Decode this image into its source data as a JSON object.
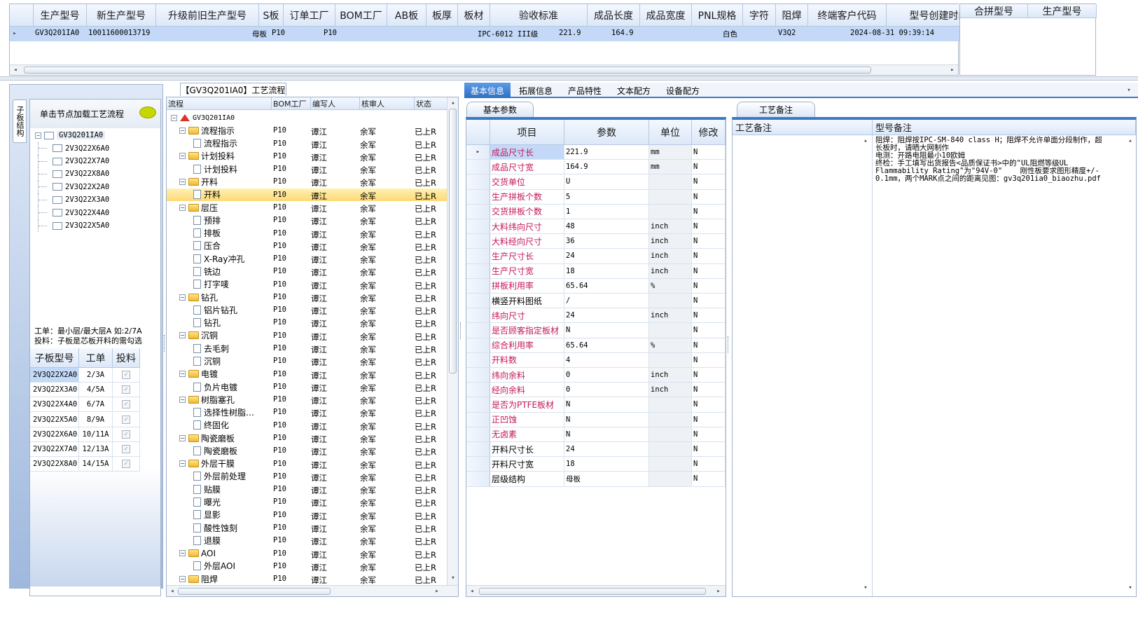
{
  "top_grid": {
    "columns": [
      "生产型号",
      "新生产型号",
      "升级前旧生产型号",
      "S板",
      "订单工厂",
      "BOM工厂",
      "AB板",
      "板厚",
      "板材",
      "验收标准",
      "成品长度",
      "成品宽度",
      "PNL规格",
      "字符",
      "阻焊",
      "终端客户代码",
      "型号创建时间"
    ],
    "row": {
      "prod_model": "GV3Q201IA0",
      "new_model": "10011600013719",
      "s_board": "母板",
      "order_factory": "P10",
      "bom_factory": "P10",
      "standard": "IPC-6012 III级",
      "length": "221.9",
      "width": "164.9",
      "char": "白色",
      "customer": "V3Q2",
      "created": "2024-08-31 09:39:14"
    },
    "side_columns": [
      "合拼型号",
      "生产型号"
    ]
  },
  "left_panel": {
    "vertical_tab": "子板结构",
    "hint": "单击节点加载工艺流程",
    "tree_root": "GV3Q201IA0",
    "tree_children": [
      "2V3Q22X6A0",
      "2V3Q22X7A0",
      "2V3Q22X8A0",
      "2V3Q22X2A0",
      "2V3Q22X3A0",
      "2V3Q22X4A0",
      "2V3Q22X5A0"
    ],
    "note_line1": "工单：最小层/最大层A 如:2/7A",
    "note_line2": "投料：子板是芯板开料的需勾选",
    "sub_columns": [
      "子板型号",
      "工单",
      "投料"
    ],
    "sub_rows": [
      {
        "model": "2V3Q22X2A0",
        "order": "2/3A"
      },
      {
        "model": "2V3Q22X3A0",
        "order": "4/5A"
      },
      {
        "model": "2V3Q22X4A0",
        "order": "6/7A"
      },
      {
        "model": "2V3Q22X5A0",
        "order": "8/9A"
      },
      {
        "model": "2V3Q22X6A0",
        "order": "10/11A"
      },
      {
        "model": "2V3Q22X7A0",
        "order": "12/13A"
      },
      {
        "model": "2V3Q22X8A0",
        "order": "14/15A"
      }
    ]
  },
  "process": {
    "title": "【GV3Q201IA0】工艺流程",
    "columns": [
      "流程",
      "BOM工厂",
      "编写人",
      "核审人",
      "状态"
    ],
    "root": "GV3Q201IA0",
    "factory": "P10",
    "writer": "谭江",
    "reviewer": "余军",
    "status": "已上R",
    "rows": [
      {
        "lvl": 1,
        "name": "流程指示"
      },
      {
        "lvl": 2,
        "name": "流程指示"
      },
      {
        "lvl": 1,
        "name": "计划投料"
      },
      {
        "lvl": 2,
        "name": "计划投料"
      },
      {
        "lvl": 1,
        "name": "开料"
      },
      {
        "lvl": 2,
        "name": "开料",
        "sel": true
      },
      {
        "lvl": 1,
        "name": "层压"
      },
      {
        "lvl": 2,
        "name": "预排"
      },
      {
        "lvl": 2,
        "name": "排板"
      },
      {
        "lvl": 2,
        "name": "压合"
      },
      {
        "lvl": 2,
        "name": "X-Ray冲孔"
      },
      {
        "lvl": 2,
        "name": "铣边"
      },
      {
        "lvl": 2,
        "name": "打字唛"
      },
      {
        "lvl": 1,
        "name": "钻孔"
      },
      {
        "lvl": 2,
        "name": "铝片钻孔"
      },
      {
        "lvl": 2,
        "name": "钻孔"
      },
      {
        "lvl": 1,
        "name": "沉铜"
      },
      {
        "lvl": 2,
        "name": "去毛刺"
      },
      {
        "lvl": 2,
        "name": "沉铜"
      },
      {
        "lvl": 1,
        "name": "电镀"
      },
      {
        "lvl": 2,
        "name": "负片电镀"
      },
      {
        "lvl": 1,
        "name": "树脂塞孔"
      },
      {
        "lvl": 2,
        "name": "选择性树脂…"
      },
      {
        "lvl": 2,
        "name": "终固化"
      },
      {
        "lvl": 1,
        "name": "陶瓷磨板"
      },
      {
        "lvl": 2,
        "name": "陶瓷磨板"
      },
      {
        "lvl": 1,
        "name": "外层干膜"
      },
      {
        "lvl": 2,
        "name": "外层前处理"
      },
      {
        "lvl": 2,
        "name": "贴膜"
      },
      {
        "lvl": 2,
        "name": "曝光"
      },
      {
        "lvl": 2,
        "name": "显影"
      },
      {
        "lvl": 2,
        "name": "酸性蚀刻"
      },
      {
        "lvl": 2,
        "name": "退膜"
      },
      {
        "lvl": 1,
        "name": "AOI"
      },
      {
        "lvl": 2,
        "name": "外层AOI"
      },
      {
        "lvl": 1,
        "name": "阻焊"
      }
    ]
  },
  "right_tabs": [
    "基本信息",
    "拓展信息",
    "产品特性",
    "文本配方",
    "设备配方"
  ],
  "basic": {
    "subtab": "基本参数",
    "columns": [
      "项目",
      "参数",
      "单位",
      "修改"
    ],
    "rows": [
      {
        "item": "成品尺寸长",
        "value": "221.9",
        "unit": "mm",
        "mod": "N",
        "red": true,
        "sel": true
      },
      {
        "item": "成品尺寸宽",
        "value": "164.9",
        "unit": "mm",
        "mod": "N",
        "red": true
      },
      {
        "item": "交货单位",
        "value": "U",
        "unit": "",
        "mod": "N",
        "red": true
      },
      {
        "item": "生产拼板个数",
        "value": "5",
        "unit": "",
        "mod": "N",
        "red": true
      },
      {
        "item": "交货拼板个数",
        "value": "1",
        "unit": "",
        "mod": "N",
        "red": true
      },
      {
        "item": "大料纬向尺寸",
        "value": "48",
        "unit": "inch",
        "mod": "N",
        "red": true
      },
      {
        "item": "大料经向尺寸",
        "value": "36",
        "unit": "inch",
        "mod": "N",
        "red": true
      },
      {
        "item": "生产尺寸长",
        "value": "24",
        "unit": "inch",
        "mod": "N",
        "red": true
      },
      {
        "item": "生产尺寸宽",
        "value": "18",
        "unit": "inch",
        "mod": "N",
        "red": true
      },
      {
        "item": "拼板利用率",
        "value": "65.64",
        "unit": "%",
        "mod": "N",
        "red": true
      },
      {
        "item": "横竖开料图纸",
        "value": "/",
        "unit": "",
        "mod": "N",
        "red": false
      },
      {
        "item": "纬向尺寸",
        "value": "24",
        "unit": "inch",
        "mod": "N",
        "red": true
      },
      {
        "item": "是否顾客指定板材",
        "value": "N",
        "unit": "",
        "mod": "N",
        "red": true
      },
      {
        "item": "综合利用率",
        "value": "65.64",
        "unit": "%",
        "mod": "N",
        "red": true
      },
      {
        "item": "开料数",
        "value": "4",
        "unit": "",
        "mod": "N",
        "red": true
      },
      {
        "item": "纬向余料",
        "value": "0",
        "unit": "inch",
        "mod": "N",
        "red": true
      },
      {
        "item": "经向余料",
        "value": "0",
        "unit": "inch",
        "mod": "N",
        "red": true
      },
      {
        "item": "是否为PTFE板材",
        "value": "N",
        "unit": "",
        "mod": "N",
        "red": true
      },
      {
        "item": "正凹蚀",
        "value": "N",
        "unit": "",
        "mod": "N",
        "red": true
      },
      {
        "item": "无卤素",
        "value": "N",
        "unit": "",
        "mod": "N",
        "red": true
      },
      {
        "item": "开料尺寸长",
        "value": "24",
        "unit": "",
        "mod": "N",
        "red": false
      },
      {
        "item": "开料尺寸宽",
        "value": "18",
        "unit": "",
        "mod": "N",
        "red": false
      },
      {
        "item": "层级结构",
        "value": "母板",
        "unit": "",
        "mod": "N",
        "red": false
      }
    ]
  },
  "remark": {
    "tab": "工艺备注",
    "col1": "工艺备注",
    "col2": "型号备注",
    "lines": [
      "阻焊：阻焊按IPC-SM-840 class H；阻焊不允许单面分段制作，超",
      "长板时，请晒大网制作",
      "电测：开路电阻最小10欧姆",
      "终检：手工填写出货报告<品质保证书>中的\"UL阻燃等级UL",
      "Flammability Rating\"为\"94V-0\"    刚性板要求图形精度+/-",
      "0.1mm，两个MARK点之间的距离见图：gv3q201ia0_biaozhu.pdf"
    ]
  }
}
